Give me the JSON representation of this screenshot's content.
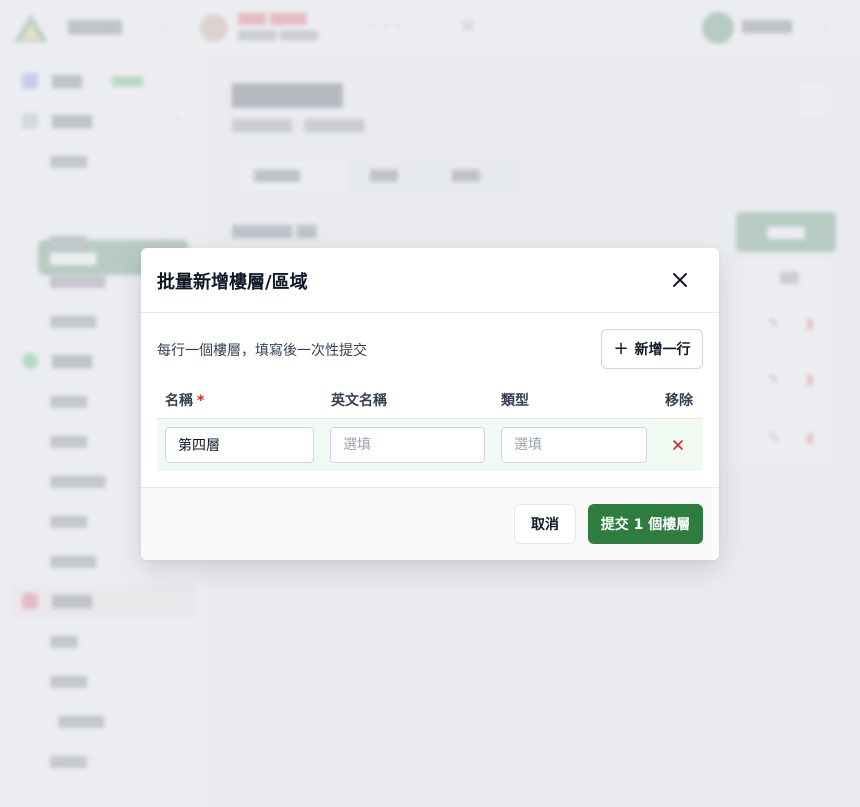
{
  "colors": {
    "primary": "#2e7d3e",
    "danger": "#dc2626",
    "row_highlight": "#f0faf3"
  },
  "modal": {
    "title": "批量新增樓層/區域",
    "hint": "每行一個樓層，填寫後一次性提交",
    "add_row_label": "新增一行",
    "columns": {
      "name": "名稱",
      "required_mark": "*",
      "english_name": "英文名稱",
      "type": "類型",
      "remove": "移除"
    },
    "rows": [
      {
        "name": "第四層",
        "english_name_placeholder": "選填",
        "type_placeholder": "選填"
      }
    ],
    "cancel_label": "取消",
    "submit_label": "提交 1 個樓層"
  },
  "icons": {
    "close": "close-icon",
    "plus": "plus-icon",
    "remove_row": "remove-row-icon"
  }
}
